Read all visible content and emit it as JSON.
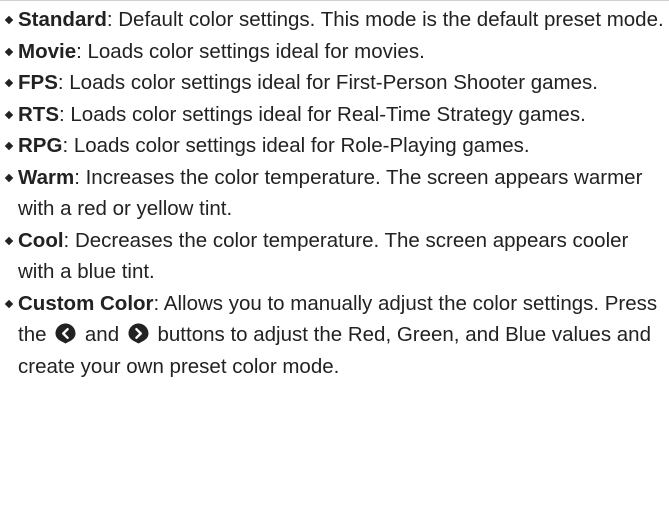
{
  "modes": [
    {
      "name": "Standard",
      "description": ": Default color settings. This mode is the default preset mode."
    },
    {
      "name": "Movie",
      "description": ": Loads color settings ideal for movies."
    },
    {
      "name": "FPS",
      "description": ": Loads color settings ideal for First-Person Shooter games."
    },
    {
      "name": "RTS",
      "description": ": Loads color settings ideal for Real-Time Strategy games."
    },
    {
      "name": "RPG",
      "description": ": Loads color settings ideal for Role-Playing games."
    },
    {
      "name": "Warm",
      "description": ": Increases the color temperature. The screen appears warmer with a red or yellow tint."
    },
    {
      "name": "Cool",
      "description": ": Decreases the color temperature. The screen appears cooler with a blue tint."
    },
    {
      "name": "Custom Color",
      "description_start": ": Allows you to manually adjust the color settings. Press the ",
      "between_buttons": " and ",
      "description_end": " buttons to adjust the Red, Green, and Blue values and create your own preset color mode."
    }
  ],
  "icons": {
    "left_button": "left-arrow-button-icon",
    "right_button": "right-arrow-button-icon"
  },
  "colors": {
    "text": "#222222",
    "button_fill": "#222222"
  }
}
